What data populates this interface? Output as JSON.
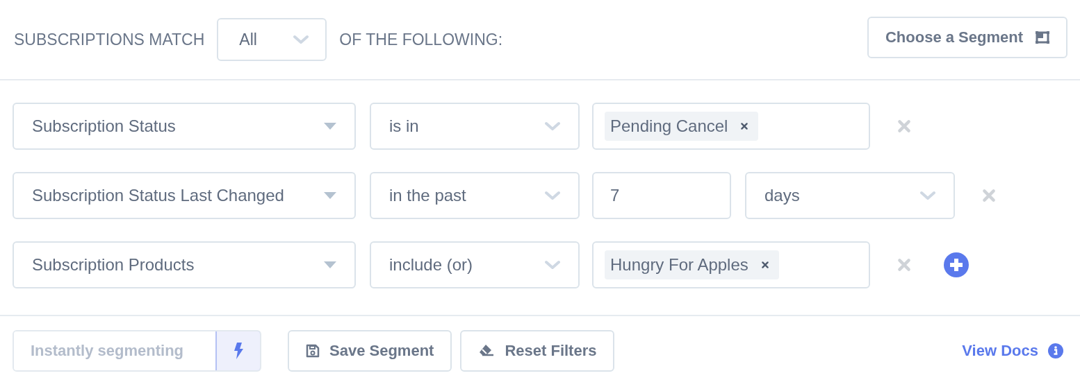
{
  "header": {
    "prefix": "SUBSCRIPTIONS MATCH",
    "match": "All",
    "suffix": "OF THE FOLLOWING:",
    "segment_button": "Choose a Segment"
  },
  "filters": [
    {
      "field": "Subscription Status",
      "operator": "is in",
      "kind": "tags",
      "tags": [
        "Pending Cancel"
      ],
      "add": false
    },
    {
      "field": "Subscription Status Last Changed",
      "operator": "in the past",
      "kind": "number",
      "value": "7",
      "unit": "days",
      "add": false
    },
    {
      "field": "Subscription Products",
      "operator": "include (or)",
      "kind": "tags",
      "tags": [
        "Hungry For Apples"
      ],
      "add": true
    }
  ],
  "footer": {
    "instant": {
      "placeholder": "Instantly segmenting"
    },
    "save": "Save Segment",
    "reset": "Reset Filters",
    "docs": "View Docs"
  }
}
